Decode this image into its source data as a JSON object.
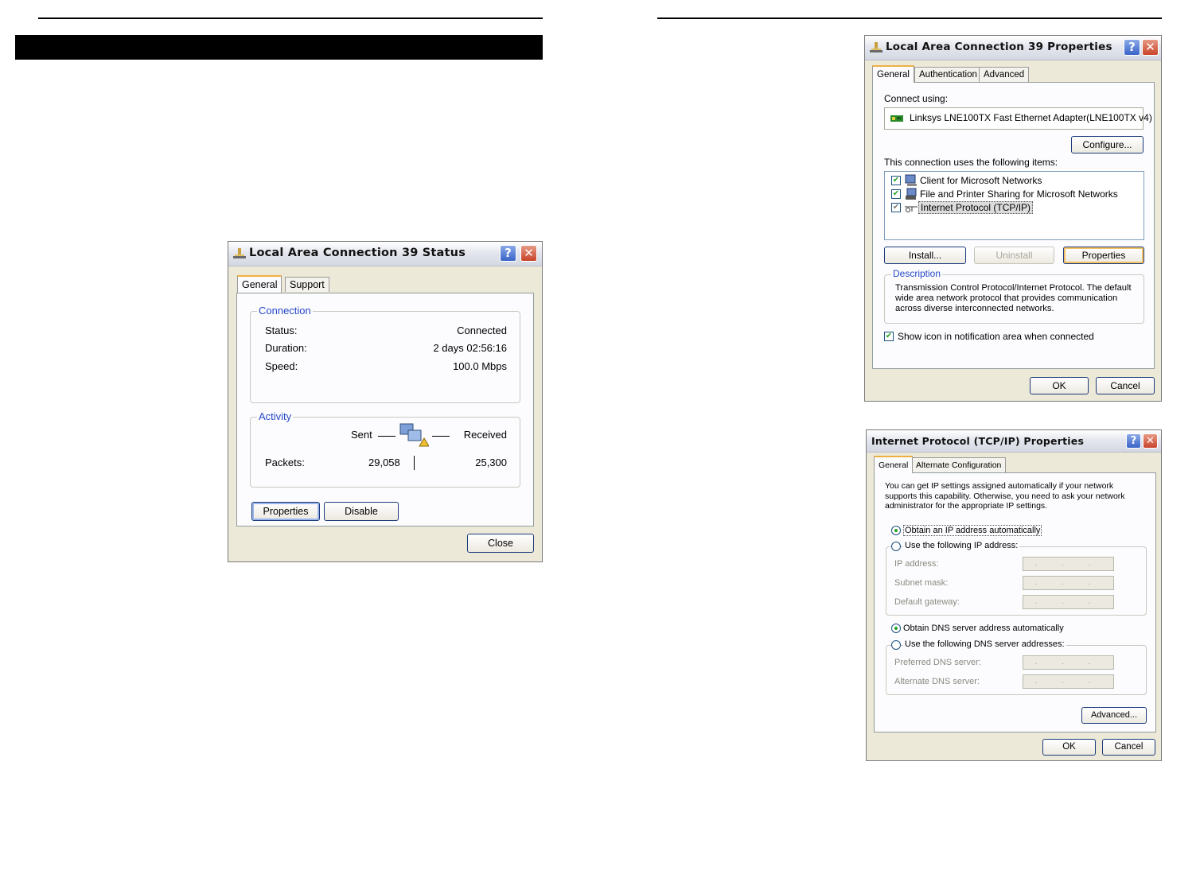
{
  "status_window": {
    "title": "Local Area Connection 39 Status",
    "tabs": [
      "General",
      "Support"
    ],
    "connection_group": "Connection",
    "status_label": "Status:",
    "status_value": "Connected",
    "duration_label": "Duration:",
    "duration_value": "2 days 02:56:16",
    "speed_label": "Speed:",
    "speed_value": "100.0 Mbps",
    "activity_group": "Activity",
    "sent_label": "Sent",
    "received_label": "Received",
    "packets_label": "Packets:",
    "packets_sent": "29,058",
    "packets_received": "25,300",
    "properties_button": "Properties",
    "disable_button": "Disable",
    "close_button": "Close"
  },
  "props_window": {
    "title": "Local Area Connection 39 Properties",
    "tabs": [
      "General",
      "Authentication",
      "Advanced"
    ],
    "connect_using_label": "Connect using:",
    "adapter": "Linksys LNE100TX Fast Ethernet Adapter(LNE100TX v4)",
    "configure_button": "Configure...",
    "items_label": "This connection uses the following items:",
    "items": [
      {
        "label": "Client for Microsoft Networks",
        "checked": true
      },
      {
        "label": "File and Printer Sharing for Microsoft Networks",
        "checked": true
      },
      {
        "label": "Internet Protocol (TCP/IP)",
        "checked": true
      }
    ],
    "install_button": "Install...",
    "uninstall_button": "Uninstall",
    "properties_button": "Properties",
    "description_group": "Description",
    "description_text": "Transmission Control Protocol/Internet Protocol. The default wide area network protocol that provides communication across diverse interconnected networks.",
    "show_icon_label": "Show icon in notification area when connected",
    "ok_button": "OK",
    "cancel_button": "Cancel"
  },
  "tcpip_window": {
    "title": "Internet Protocol (TCP/IP) Properties",
    "tabs": [
      "General",
      "Alternate Configuration"
    ],
    "intro_text": "You can get IP settings assigned automatically if your network supports this capability. Otherwise, you need to ask your network administrator for the appropriate IP settings.",
    "obtain_ip": "Obtain an IP address automatically",
    "use_ip": "Use the following IP address:",
    "ip_address_label": "IP address:",
    "subnet_label": "Subnet mask:",
    "gateway_label": "Default gateway:",
    "obtain_dns": "Obtain DNS server address automatically",
    "use_dns": "Use the following DNS server addresses:",
    "preferred_dns_label": "Preferred DNS server:",
    "alternate_dns_label": "Alternate DNS server:",
    "ip_placeholder": ". . .",
    "advanced_button": "Advanced...",
    "ok_button": "OK",
    "cancel_button": "Cancel"
  }
}
